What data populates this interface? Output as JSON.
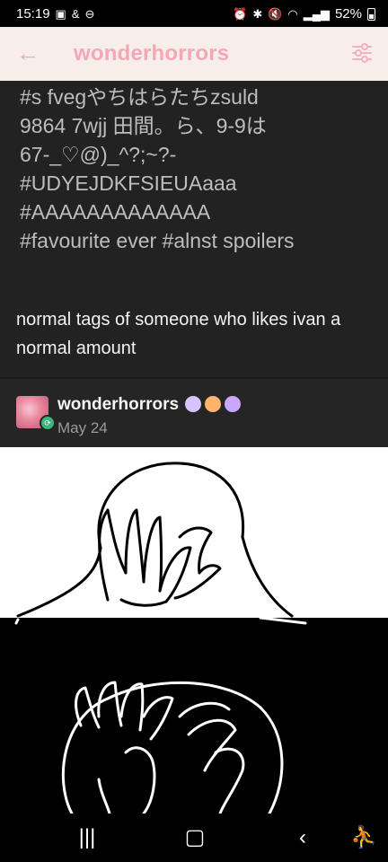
{
  "status_bar": {
    "time": "15:19",
    "left_extra": "&",
    "battery": "52%"
  },
  "app_bar": {
    "title": "wonderhorrors"
  },
  "post": {
    "tags": [
      "#s fvegやちはらたちzsuld",
      "9864 7wjj 田間。ら、9-9は",
      "67-_♡@)_^?;~?-",
      "#UDYEJDKFSIEUAaaa",
      "#AAAAAAAAAAAAA",
      "#favourite ever  #alnst spoilers"
    ],
    "body": "normal tags of someone who likes ivan a normal amount"
  },
  "reblog": {
    "username": "wonderhorrors",
    "date": "May 24",
    "badge_colors": [
      "#d7c4ff",
      "#ffb36b",
      "#c9a7ff"
    ]
  },
  "colors": {
    "accent": "#f4a7ba",
    "app_bar_bg": "#f6eee7",
    "reblog_green": "#3bb57c"
  }
}
